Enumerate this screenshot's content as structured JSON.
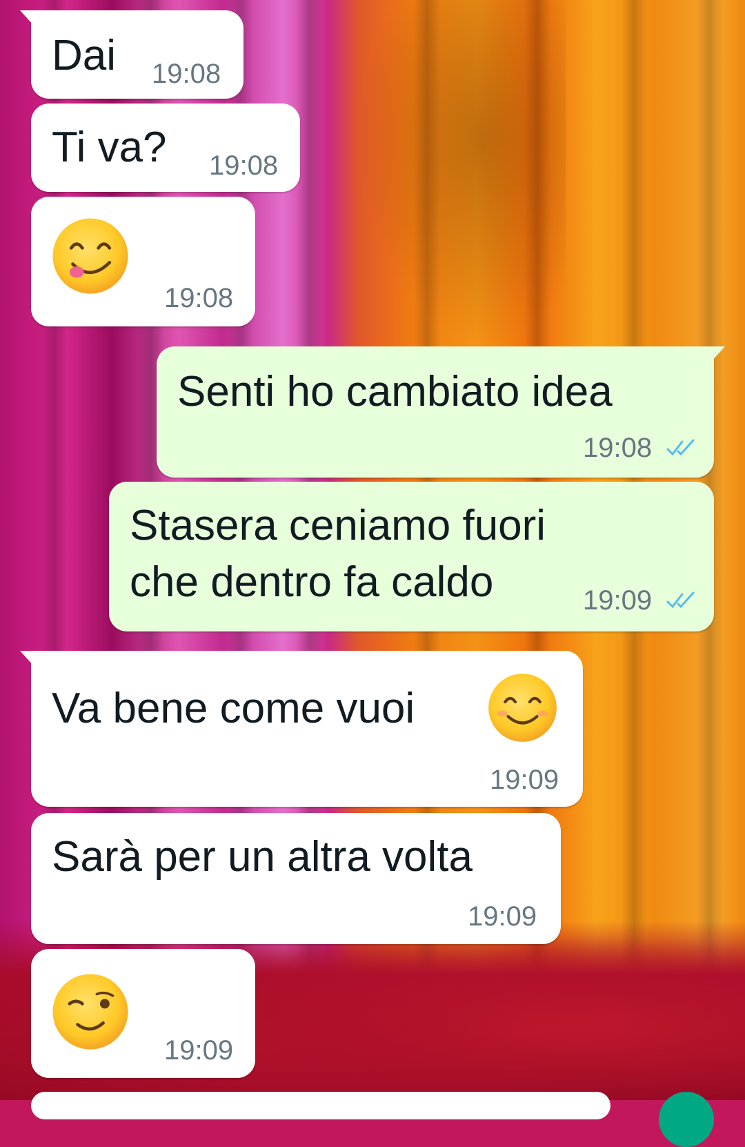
{
  "chat": {
    "messages": [
      {
        "direction": "incoming",
        "text": "Dai",
        "time": "19:08"
      },
      {
        "direction": "incoming",
        "text": "Ti va?",
        "time": "19:08"
      },
      {
        "direction": "incoming",
        "emoji": "face-savoring-food-emoji",
        "time": "19:08"
      },
      {
        "direction": "outgoing",
        "text": "Senti ho cambiato idea",
        "time": "19:08",
        "status": "read"
      },
      {
        "direction": "outgoing",
        "text_line1": "Stasera ceniamo fuori",
        "text_line2": "che dentro fa caldo",
        "time": "19:09",
        "status": "read"
      },
      {
        "direction": "incoming",
        "text": "Va bene come vuoi",
        "emoji": "smiling-face-emoji",
        "time": "19:09"
      },
      {
        "direction": "incoming",
        "text": "Sarà per un altra volta",
        "time": "19:09"
      },
      {
        "direction": "incoming",
        "emoji": "winking-face-emoji",
        "time": "19:09"
      }
    ]
  },
  "colors": {
    "incoming_bubble": "#ffffff",
    "outgoing_bubble": "#e7ffdb",
    "timestamp": "#667781",
    "read_ticks": "#53bdeb",
    "accent": "#00a884"
  }
}
